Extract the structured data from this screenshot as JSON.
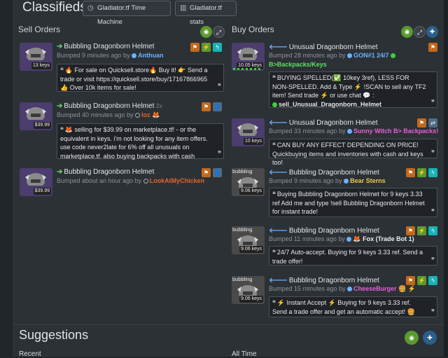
{
  "header": {
    "title": "Classifieds",
    "btn_time_machine": "Gladiator.tf Time Machine",
    "btn_stats": "Gladiator.tf stats"
  },
  "sell": {
    "title": "Sell Orders",
    "items": [
      {
        "title": "Bubbling Dragonborn Helmet",
        "count": "",
        "bumped": "Bumped 9 minutes ago by ",
        "user": "Anthuan",
        "user_color": "#6ab3ff",
        "keys": "13 keys",
        "message": "🔥 For sale on Quicksell.store🔥 Buy it! 👉 Send a trade or visit https://quicksell.store/buy/17167866965 👍 Over 10k items for sale!"
      },
      {
        "title": "Bubbling Dragonborn Helmet",
        "count": "2x",
        "bumped": "Bumped 40 minutes ago by ",
        "user": "loz",
        "user_color": "#e0662c",
        "keys": "$39.99",
        "message": "🦊 selling for $39.99 on marketplace.tf! - or the equivalent in keys. i'm not looking for any item offers. use code never2late for 6% off all unusuals on marketplace.tf. also buying backpacks with cash"
      },
      {
        "title": "Bubbling Dragonborn Helmet",
        "count": "",
        "bumped": "Bumped about an hour ago by ",
        "user": "LookAtMyChicken",
        "user_color": "#e0662c",
        "keys": "$39.99",
        "message": ""
      }
    ]
  },
  "buy": {
    "title": "Buy Orders",
    "items": [
      {
        "title": "Unusual Dragonborn Helmet",
        "bumped": "Bumped 28 minutes ago by ",
        "user": "GON#1 24/7",
        "user2": "B>Backpacks/Keys",
        "user_color": "#6ab3ff",
        "keys": "10.05 keys",
        "message_a": "BUYING SPELLED(✅ 10key 3ref), LESS FOR NON-SPELLED.",
        "message_b": "Add & Type ⚡ !SCAN to sell any TF2 item! Send  trade ⚡ or use  chat 💬 :",
        "message_c": "sell_Unusual_Dragonborn_Helmet"
      },
      {
        "title": "Unusual Dragonborn Helmet",
        "bumped": "Bumped 33 minutes ago by ",
        "user": "Sunny Witch B> Backpacks!",
        "user_color": "#e65fd6",
        "keys": "10 keys",
        "message": "CAN BUY ANY EFFECT DEPENDING ON PRICE! Quickbuying items and inventories with cash and keys too!"
      },
      {
        "title": "Bubbling Dragonborn Helmet",
        "bumped": "Bumped 9 minutes ago by ",
        "user": "Bear Sterns",
        "user_color": "#ecc94b",
        "keys": "9.06 keys",
        "top": "bubbling",
        "message": "Buying Bubbling Dragonborn Helmet for 9 keys 3.33 ref Add me and type !sell Bubbling Dragonborn Helmet for instant trade!"
      },
      {
        "title": "Bubbling Dragonborn Helmet",
        "bumped": "Bumped 11 minutes ago by ",
        "user": "Fox (Trade Bot 1)",
        "user_color": "#eeeeee",
        "keys": "9.06 keys",
        "top": "bubbling",
        "message": "24/7 Auto-accept. Buying for 9 keys 3.33 ref. Send a trade offer!"
      },
      {
        "title": "Bubbling Dragonborn Helmet",
        "bumped": "Bumped 15 minutes ago by ",
        "user": "CheeseBurger",
        "user_color": "#e65fd6",
        "keys": "9.06 keys",
        "top": "bubbling",
        "message": "⚡ Instant Accept ⚡ Buying for 9 keys 3.33 ref. Send a trade offer and get an automatic accept! 🍔"
      }
    ]
  },
  "footer": {
    "title": "Suggestions",
    "recent": "Recent",
    "all_time": "All Time"
  },
  "colors": {
    "accent_green": "#5a9a2e",
    "accent_orange": "#c2691b",
    "accent_cyan": "#18b3b6",
    "bg": "#2c3136"
  }
}
